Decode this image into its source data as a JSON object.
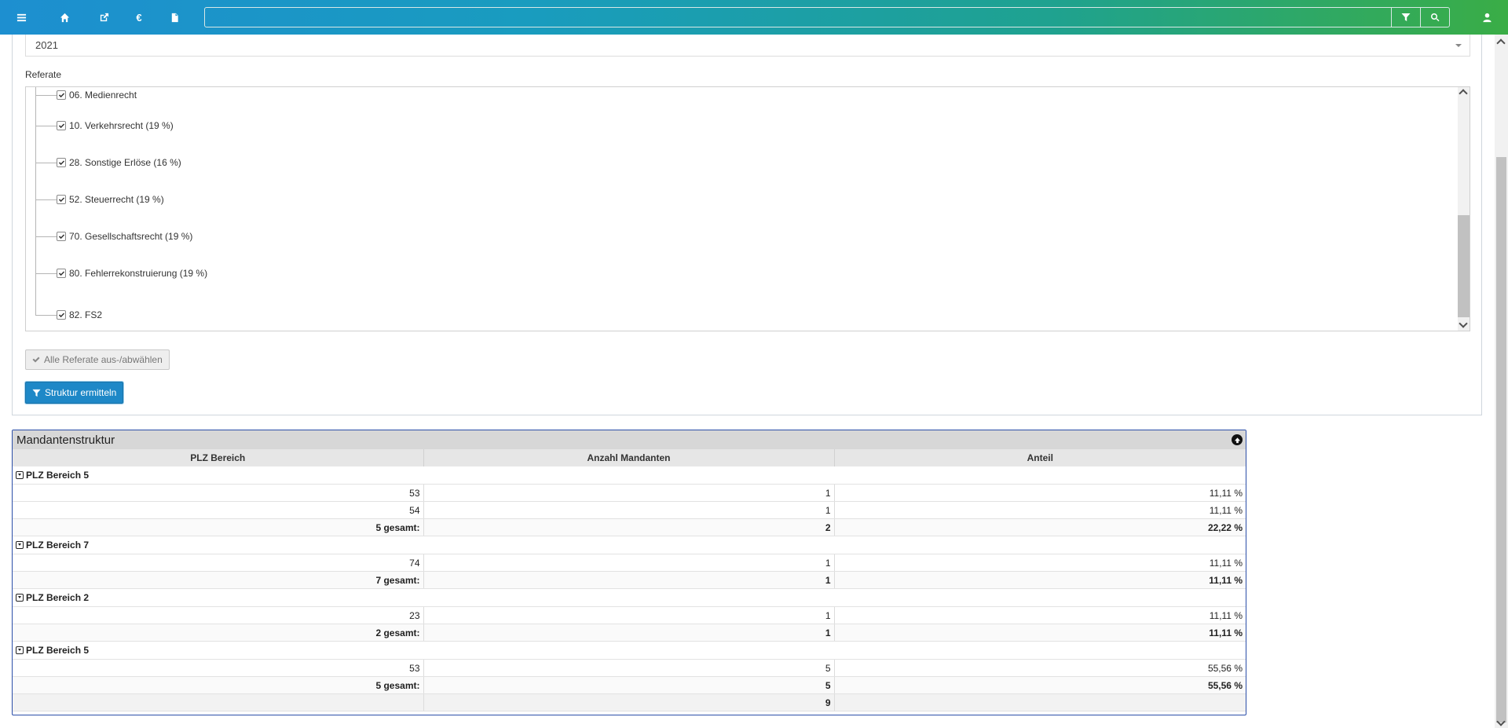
{
  "topbar": {
    "icons": [
      "menu-icon",
      "home-icon",
      "external-link-icon",
      "euro-icon",
      "document-icon"
    ],
    "search": {
      "value": "",
      "placeholder": ""
    },
    "buttons": [
      "filter-icon",
      "search-icon",
      "user-icon"
    ]
  },
  "filter": {
    "year": "2021",
    "referate_label": "Referate",
    "referate": [
      "06. Medienrecht",
      "10. Verkehrsrecht (19 %)",
      "28. Sonstige Erlöse (16 %)",
      "52. Steuerrecht (19 %)",
      "70. Gesellschaftsrecht (19 %)",
      "80. Fehlerrekonstruierung (19 %)",
      "82. FS2"
    ],
    "toggle_all_label": "Alle Referate aus-/abwählen",
    "submit_label": "Struktur ermitteln"
  },
  "result": {
    "title": "Mandantenstruktur",
    "columns": [
      "PLZ Bereich",
      "Anzahl Mandanten",
      "Anteil"
    ],
    "rows": [
      {
        "type": "group",
        "label": "PLZ Bereich 5"
      },
      {
        "type": "data",
        "plz": "53",
        "count": "1",
        "share": "11,11 %"
      },
      {
        "type": "data",
        "plz": "54",
        "count": "1",
        "share": "11,11 %"
      },
      {
        "type": "sub",
        "plz": "5 gesamt:",
        "count": "2",
        "share": "22,22 %"
      },
      {
        "type": "group",
        "label": "PLZ Bereich 7"
      },
      {
        "type": "data",
        "plz": "74",
        "count": "1",
        "share": "11,11 %"
      },
      {
        "type": "sub",
        "plz": "7 gesamt:",
        "count": "1",
        "share": "11,11 %"
      },
      {
        "type": "group",
        "label": "PLZ Bereich 2"
      },
      {
        "type": "data",
        "plz": "23",
        "count": "1",
        "share": "11,11 %"
      },
      {
        "type": "sub",
        "plz": "2 gesamt:",
        "count": "1",
        "share": "11,11 %"
      },
      {
        "type": "group",
        "label": "PLZ Bereich 5"
      },
      {
        "type": "data",
        "plz": "53",
        "count": "5",
        "share": "55,56 %"
      },
      {
        "type": "sub",
        "plz": "5 gesamt:",
        "count": "5",
        "share": "55,56 %"
      },
      {
        "type": "total",
        "plz": "",
        "count": "9",
        "share": ""
      }
    ]
  }
}
